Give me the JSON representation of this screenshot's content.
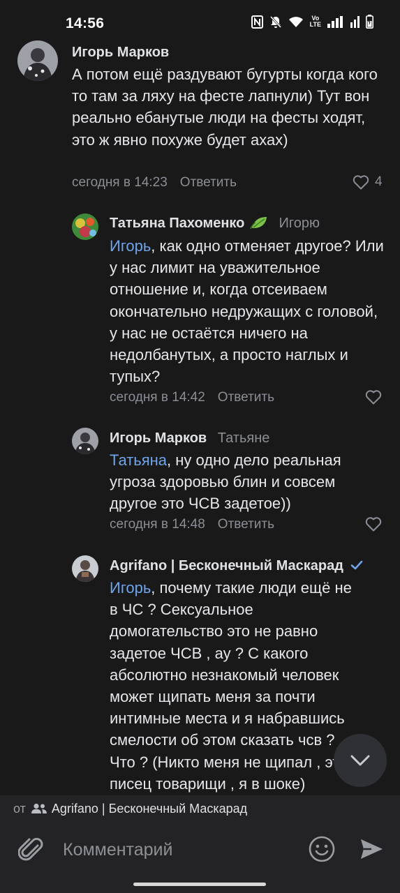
{
  "status_bar": {
    "time": "14:56",
    "network_label": "Vo\nLTE"
  },
  "comments": [
    {
      "author": "Игорь Марков",
      "reply_to": "",
      "mention": "",
      "text": "А потом ещё раздувают бугурты когда кого то там за ляху на фесте лапнули) Тут вон реально ебанутые люди на фесты ходят, это ж явно похуже будет ахах)",
      "time": "сегодня в 14:23",
      "reply_label": "Ответить",
      "likes": "4"
    },
    {
      "author": "Татьяна Пахоменко",
      "reply_to": "Игорю",
      "mention": "Игорь",
      "text": ", как одно отменяет другое? Или у нас лимит на уважительное отношение и, когда отсеиваем окончательно недружащих с головой, у нас не остаётся ничего на недолбанутых, а просто наглых и тупых?",
      "time": "сегодня в 14:42",
      "reply_label": "Ответить",
      "likes": ""
    },
    {
      "author": "Игорь Марков",
      "reply_to": "Татьяне",
      "mention": "Татьяна",
      "text": ", ну одно дело реальная угроза здоровью блин и совсем другое это ЧСВ задетое))",
      "time": "сегодня в 14:48",
      "reply_label": "Ответить",
      "likes": ""
    },
    {
      "author": "Agrifano | Бесконечный Маскарад",
      "reply_to": "",
      "mention": "Игорь",
      "text": ", почему такие люди ещё не в ЧС ? Сексуальное домогательство это не равно задетое ЧСВ , ау ? С какого абсолютно незнакомый человек может щипать меня за почти интимные места и я набравшись смелости об этом сказать чсв ? Что ? (Никто меня не щипал , это писец товарищи , я в шоке)",
      "time": "",
      "reply_label": "",
      "likes": ""
    }
  ],
  "composer": {
    "from_prefix": "от",
    "from_name": "Agrifano | Бесконечный Маскарад",
    "placeholder": "Комментарий"
  },
  "icons": [
    "nfc-icon",
    "mute-icon",
    "wifi-icon",
    "signal-icon",
    "battery-icon",
    "heart-icon",
    "leaf-emoji-icon",
    "verified-icon",
    "chevron-down-icon",
    "group-icon",
    "paperclip-icon",
    "smile-icon",
    "send-icon"
  ],
  "colors": {
    "background": "#19191a",
    "panel": "#232325",
    "mention": "#6ea4ea",
    "muted": "#8b8e94",
    "verified": "#6ea4ea"
  }
}
